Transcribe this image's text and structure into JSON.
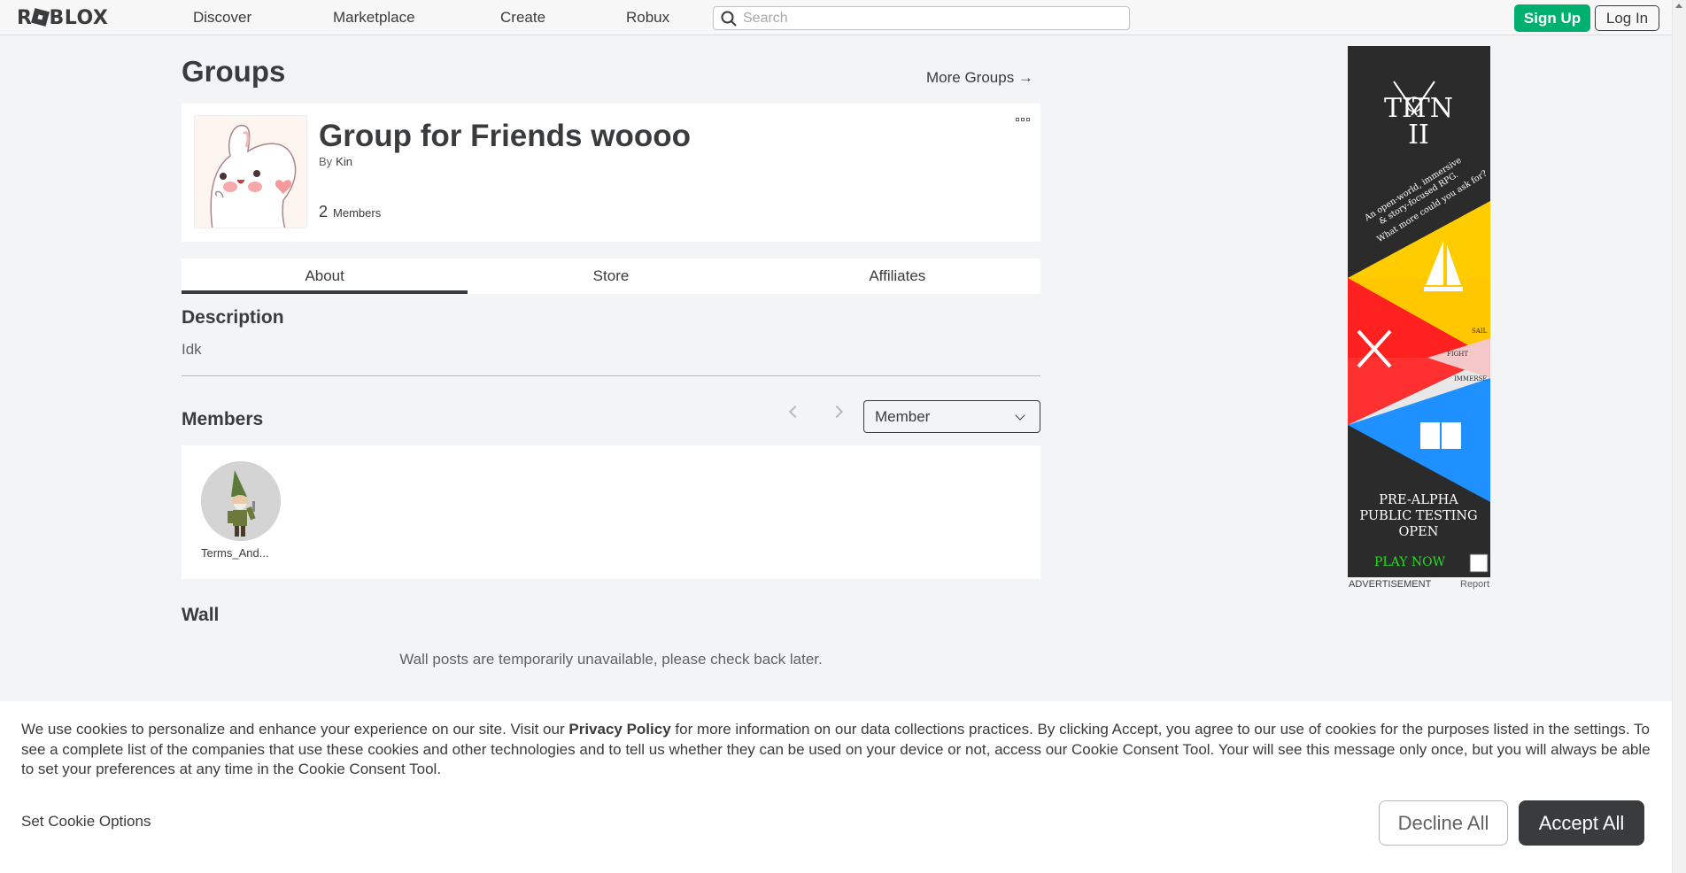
{
  "nav": {
    "logo": "ROBLOX",
    "links": [
      "Discover",
      "Marketplace",
      "Create",
      "Robux"
    ],
    "search_placeholder": "Search",
    "signup": "Sign Up",
    "login": "Log In"
  },
  "page": {
    "title": "Groups",
    "more_groups": "More Groups →"
  },
  "group": {
    "name": "Group for Friends woooo",
    "by_label": "By",
    "owner": "Kin",
    "member_count": "2",
    "member_label": "Members"
  },
  "tabs": [
    {
      "label": "About",
      "active": true
    },
    {
      "label": "Store",
      "active": false
    },
    {
      "label": "Affiliates",
      "active": false
    }
  ],
  "description": {
    "heading": "Description",
    "text": "Idk"
  },
  "members": {
    "heading": "Members",
    "role_selected": "Member",
    "list": [
      {
        "name": "Terms_And..."
      }
    ]
  },
  "wall": {
    "heading": "Wall",
    "message": "Wall posts are temporarily unavailable, please check back later."
  },
  "ad": {
    "title_line1": "TITN",
    "title_line2": "II",
    "tagline1": "An open-world, immersive",
    "tagline2": "& story-focused RPG.",
    "tagline3": "What more could you ask for?",
    "sail": "SAIL",
    "fight": "FIGHT",
    "immerse": "IMMERSE",
    "status_line1": "PRE-ALPHA",
    "status_line2": "PUBLIC TESTING",
    "status_line3": "OPEN",
    "cta": "PLAY NOW",
    "label": "ADVERTISEMENT",
    "report": "Report"
  },
  "cookie": {
    "text_before": "We use cookies to personalize and enhance your experience on our site. Visit our ",
    "privacy_link": "Privacy Policy",
    "text_after": " for more information on our data collections practices. By clicking Accept, you agree to our use of cookies for the purposes listed in the settings. To see a complete list of the companies that use these cookies and other technologies and to tell us whether they can be used on your device or not, access our Cookie Consent Tool. Your will see this message only once, but you will always be able to set your preferences at any time in the Cookie Consent Tool.",
    "set_options": "Set Cookie Options",
    "decline": "Decline All",
    "accept": "Accept All"
  },
  "colors": {
    "signup_green": "#00b06f",
    "text_dark": "#393b3d",
    "background": "#f2f4f5"
  }
}
